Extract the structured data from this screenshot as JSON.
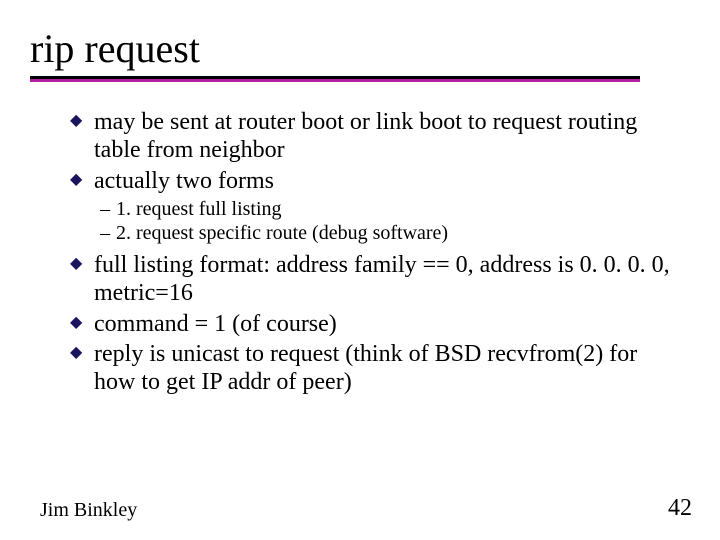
{
  "title": "rip request",
  "bullets_top": [
    "may be sent at router boot or link boot to request routing table from neighbor",
    "actually two forms"
  ],
  "sub_bullets": [
    "1. request full listing",
    "2. request specific route (debug software)"
  ],
  "bullets_bottom": [
    "full listing format: address family == 0, address is 0. 0. 0. 0,  metric=16",
    "command = 1 (of course)",
    "reply is unicast to request (think of BSD recvfrom(2) for how to get IP addr of peer)"
  ],
  "footer": {
    "author": "Jim Binkley",
    "page": "42"
  }
}
